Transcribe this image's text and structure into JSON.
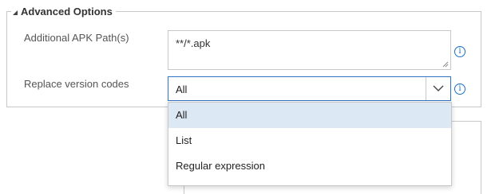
{
  "advanced_options": {
    "legend": "Advanced Options",
    "fields": {
      "apk_paths": {
        "label": "Additional APK Path(s)",
        "value": "**/*.apk"
      },
      "replace_version_codes": {
        "label": "Replace version codes",
        "selected": "All",
        "options": [
          "All",
          "List",
          "Regular expression"
        ]
      }
    }
  },
  "icons": {
    "info_glyph": "i",
    "expand": "caret-expanded-icon",
    "dropdown": "chevron-down-icon"
  },
  "colors": {
    "accent": "#2f74c7",
    "info": "#1a6fc9",
    "selected_option_bg": "#dde8f5",
    "border": "#c8c8c8"
  }
}
